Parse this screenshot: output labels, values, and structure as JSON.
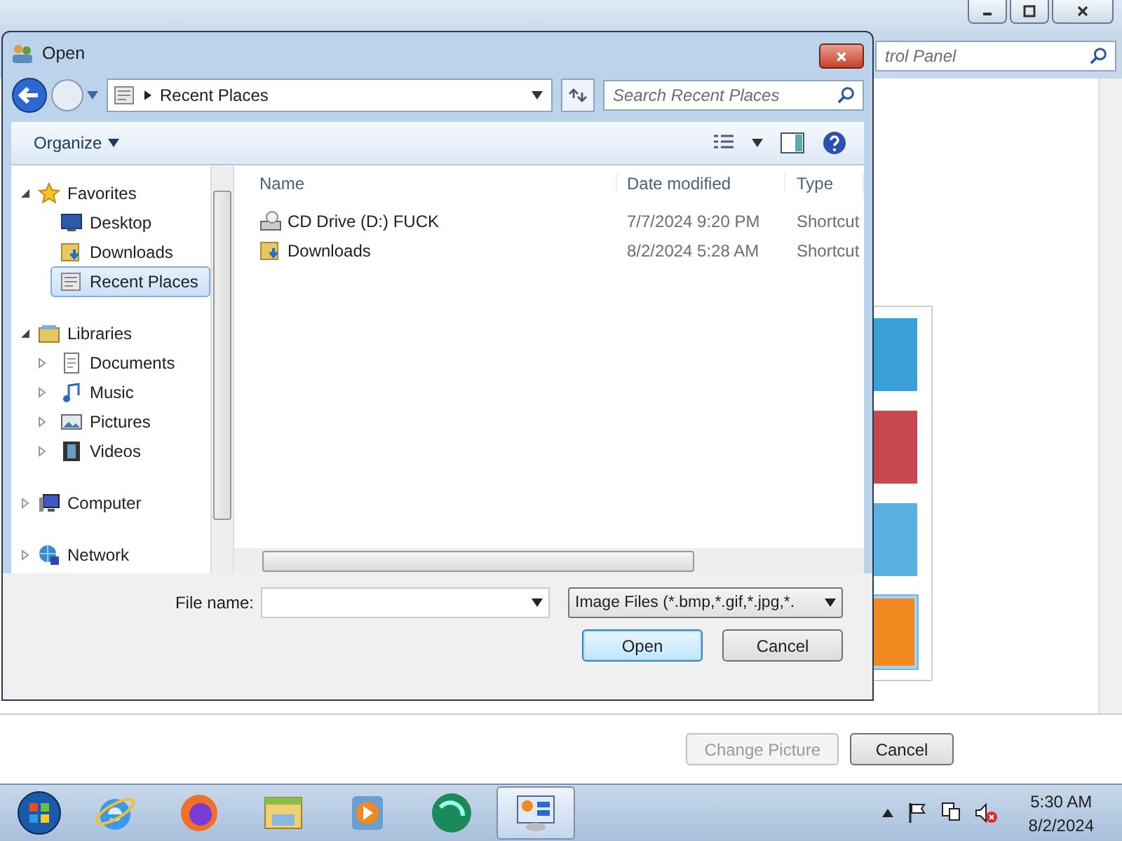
{
  "background_window": {
    "search": {
      "placeholder": "trol Panel"
    },
    "thumbnails": [
      {
        "selected": false
      },
      {
        "selected": false
      },
      {
        "selected": false
      },
      {
        "selected": true
      }
    ],
    "buttons": [
      {
        "label": "Change Picture",
        "disabled": true
      },
      {
        "label": "Cancel",
        "disabled": false
      }
    ]
  },
  "dialog": {
    "title": "Open",
    "address": {
      "crumbs": [
        "Recent Places"
      ]
    },
    "search": {
      "placeholder": "Search Recent Places"
    },
    "toolbar": {
      "organize": "Organize"
    },
    "nav": [
      {
        "label": "Favorites",
        "kind": "star",
        "expanded": true,
        "selected": false,
        "children": [
          {
            "label": "Desktop",
            "kind": "desktop",
            "selected": false
          },
          {
            "label": "Downloads",
            "kind": "downloads",
            "selected": false
          },
          {
            "label": "Recent Places",
            "kind": "recent",
            "selected": true
          }
        ]
      },
      {
        "label": "Libraries",
        "kind": "library",
        "expanded": true,
        "selected": false,
        "children": [
          {
            "label": "Documents",
            "kind": "documents",
            "expanded": false,
            "selected": false
          },
          {
            "label": "Music",
            "kind": "music",
            "expanded": false,
            "selected": false
          },
          {
            "label": "Pictures",
            "kind": "pictures",
            "expanded": false,
            "selected": false
          },
          {
            "label": "Videos",
            "kind": "videos",
            "expanded": false,
            "selected": false
          }
        ]
      },
      {
        "label": "Computer",
        "kind": "computer",
        "expanded": false,
        "selected": false
      },
      {
        "label": "Network",
        "kind": "network",
        "expanded": false,
        "selected": false
      }
    ],
    "columns": [
      "Name",
      "Date modified",
      "Type"
    ],
    "rows": [
      {
        "kind": "drive",
        "name": "CD Drive (D:) FUCK",
        "date": "7/7/2024 9:20 PM",
        "type": "Shortcut"
      },
      {
        "kind": "downloads",
        "name": "Downloads",
        "date": "8/2/2024 5:28 AM",
        "type": "Shortcut"
      }
    ],
    "file_name": {
      "label": "File name:"
    },
    "file_type": "Image Files (*.bmp,*.gif,*.jpg,*.",
    "buttons": [
      {
        "label": "Open",
        "default": true
      },
      {
        "label": "Cancel",
        "default": false
      }
    ]
  },
  "taskbar": {
    "apps": [
      {
        "kind": "start",
        "selected": false
      },
      {
        "kind": "ie",
        "selected": false
      },
      {
        "kind": "firefox",
        "selected": false
      },
      {
        "kind": "explorer",
        "selected": false
      },
      {
        "kind": "media",
        "selected": false
      },
      {
        "kind": "green",
        "selected": false
      },
      {
        "kind": "control",
        "selected": true
      }
    ],
    "time": "5:30 AM",
    "date": "8/2/2024"
  }
}
